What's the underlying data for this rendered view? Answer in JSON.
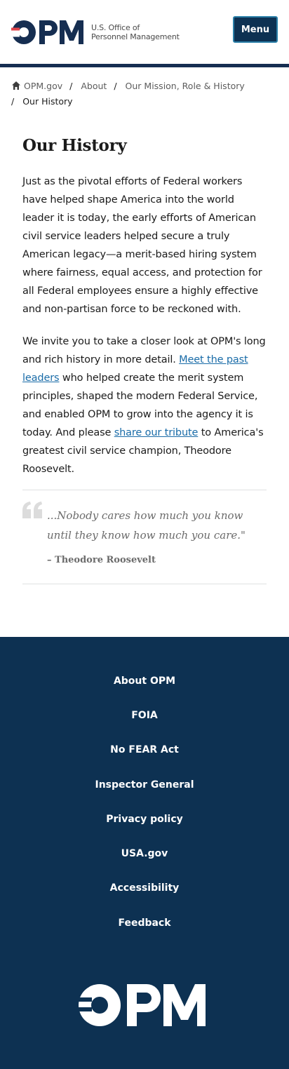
{
  "header": {
    "agency_line1": "U.S. Office of",
    "agency_line2": "Personnel Management",
    "menu_label": "Menu"
  },
  "breadcrumb": {
    "items": [
      "OPM.gov",
      "About",
      "Our Mission, Role & History"
    ],
    "separator": "/",
    "current": "Our History"
  },
  "main": {
    "title": "Our History",
    "para1": "Just as the pivotal efforts of Federal workers have helped shape America into the world leader it is today, the early efforts of American civil service leaders helped secure a truly American legacy—a merit-based hiring system where fairness, equal access, and protection for all Federal employees ensure a highly effective and non-partisan force to be reckoned with.",
    "para2_a": "We invite you to take a closer look at OPM's long and rich history in more detail. ",
    "para2_link1": "Meet the past leaders",
    "para2_b": " who helped create the merit system principles, shaped the modern Federal Service, and enabled OPM to grow into the agency it is today. And please ",
    "para2_link2": "share our tribute",
    "para2_c": " to America's greatest civil service champion, Theodore Roosevelt.",
    "quote_text": "...Nobody cares how much you know until they know how much you care.\"",
    "quote_author": "– Theodore Roosevelt"
  },
  "footer": {
    "links": [
      "About OPM",
      "FOIA",
      "No FEAR Act",
      "Inspector General",
      "Privacy policy",
      "USA.gov",
      "Accessibility",
      "Feedback"
    ]
  },
  "colors": {
    "navy": "#0d3152",
    "brand_red": "#e0444b",
    "link_blue": "#1a6ca8"
  }
}
